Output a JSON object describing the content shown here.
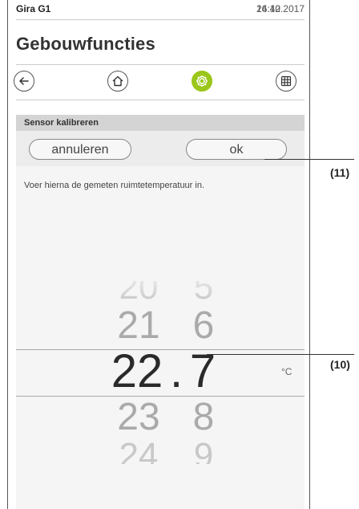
{
  "status": {
    "brand": "Gira G1",
    "time": "14:42",
    "date": "26.10.2017"
  },
  "page": {
    "title": "Gebouwfuncties"
  },
  "nav": {
    "back_icon": "arrow-left-icon",
    "home_icon": "home-icon",
    "functions_icon": "gear-icon",
    "overview_icon": "grid-icon",
    "accent_color": "#9bc61a"
  },
  "dialog": {
    "header": "Sensor kalibreren",
    "cancel_label": "annuleren",
    "ok_label": "ok",
    "instruction": "Voer hierna de gemeten ruimtetemperatuur in."
  },
  "picker": {
    "integer_values": [
      "20",
      "21",
      "22",
      "23",
      "24"
    ],
    "decimal_values": [
      "5",
      "6",
      "7",
      "8",
      "9"
    ],
    "selected_integer": "22",
    "selected_decimal": "7",
    "separator": ".",
    "unit": "°C"
  },
  "callouts": {
    "ok": "(11)",
    "picker": "(10)"
  }
}
